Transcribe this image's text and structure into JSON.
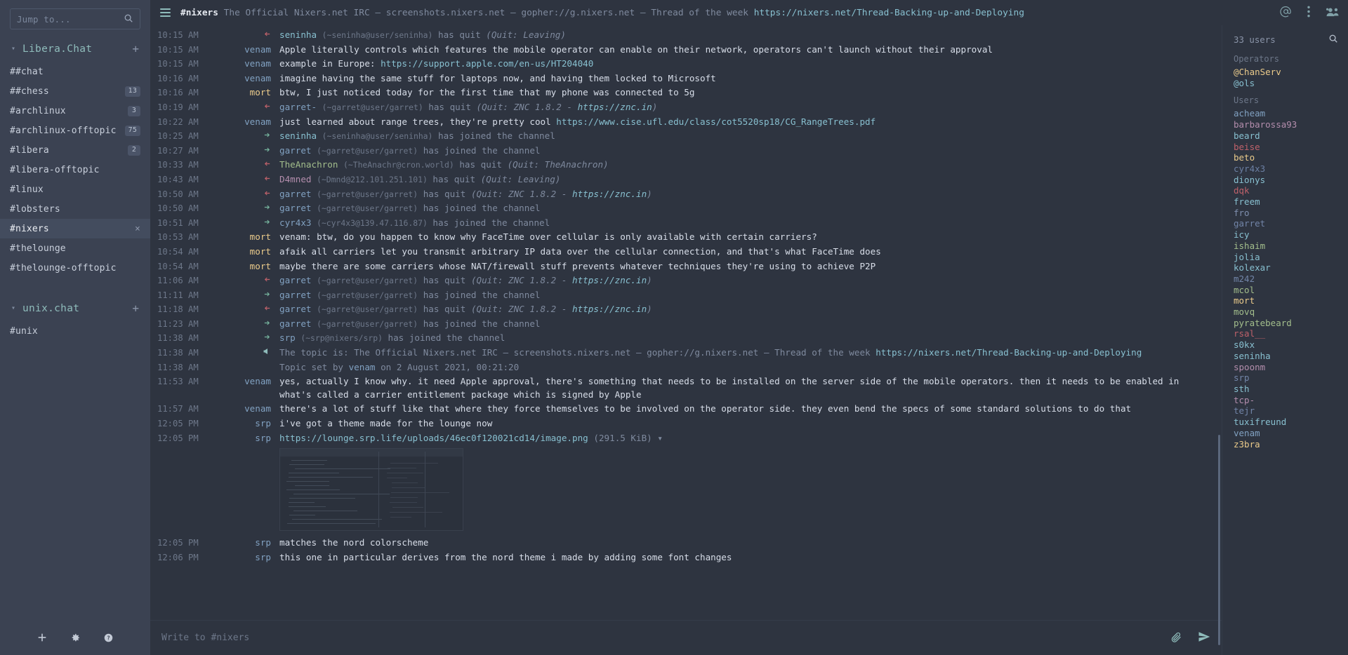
{
  "sidebar": {
    "search_placeholder": "Jump to...",
    "search_icon": "search-icon",
    "networks": [
      {
        "name": "Libera.Chat",
        "add_label": "+",
        "channels": [
          {
            "name": "##chat",
            "badge": "",
            "active": false
          },
          {
            "name": "##chess",
            "badge": "13",
            "active": false
          },
          {
            "name": "#archlinux",
            "badge": "3",
            "active": false
          },
          {
            "name": "#archlinux-offtopic",
            "badge": "75",
            "active": false
          },
          {
            "name": "#libera",
            "badge": "2",
            "active": false
          },
          {
            "name": "#libera-offtopic",
            "badge": "",
            "active": false
          },
          {
            "name": "#linux",
            "badge": "",
            "active": false
          },
          {
            "name": "#lobsters",
            "badge": "",
            "active": false
          },
          {
            "name": "#nixers",
            "badge": "",
            "active": true,
            "close": "×"
          },
          {
            "name": "#thelounge",
            "badge": "",
            "active": false
          },
          {
            "name": "#thelounge-offtopic",
            "badge": "",
            "active": false
          }
        ]
      },
      {
        "name": "unix.chat",
        "add_label": "+",
        "channels": [
          {
            "name": "#unix",
            "badge": "",
            "active": false
          }
        ]
      }
    ],
    "bottom_icons": [
      "plus-icon",
      "gear-icon",
      "help-icon"
    ]
  },
  "header": {
    "menu_icon": "hamburger-menu-icon",
    "channel": "#nixers",
    "topic_parts": [
      {
        "t": "The Official Nixers.net IRC — screenshots.nixers.net — gopher://g.nixers.net — Thread of the week ",
        "link": false
      },
      {
        "t": "https://nixers.net/Thread-Backing-up-and-Deploying",
        "link": true
      }
    ],
    "icons": [
      "mention-icon",
      "kebab-menu-icon",
      "user-list-icon"
    ]
  },
  "messages": [
    {
      "time": "10:15 AM",
      "kind": "quit",
      "nick": "seninha",
      "nickclass": "c-seninha",
      "host": "(~seninha@user/seninha)",
      "action": " has quit ",
      "quit": "(Quit: Leaving)"
    },
    {
      "time": "10:15 AM",
      "kind": "msg",
      "nick": "venam",
      "nickclass": "c-venam",
      "text": "Apple literally controls which features the mobile operator can enable on their network, operators can't launch without their approval"
    },
    {
      "time": "10:15 AM",
      "kind": "msg",
      "nick": "venam",
      "nickclass": "c-venam",
      "text": "example in Europe: ",
      "link": "https://support.apple.com/en-us/HT204040"
    },
    {
      "time": "10:16 AM",
      "kind": "msg",
      "nick": "venam",
      "nickclass": "c-venam",
      "text": "imagine having the same stuff for laptops now, and having them locked to Microsoft"
    },
    {
      "time": "10:16 AM",
      "kind": "msg",
      "nick": "mort",
      "nickclass": "c-mort",
      "text": "btw, I just noticed today for the first time that my phone was connected to 5g"
    },
    {
      "time": "10:19 AM",
      "kind": "quit",
      "nick": "garret-",
      "nickclass": "c-garret",
      "host": "(~garret@user/garret)",
      "action": " has quit ",
      "quit": "(Quit: ZNC 1.8.2 - https://znc.in)",
      "quitlink": "https://znc.in"
    },
    {
      "time": "10:22 AM",
      "kind": "msg",
      "nick": "venam",
      "nickclass": "c-venam",
      "text": "just learned about range trees, they're pretty cool ",
      "link": "https://www.cise.ufl.edu/class/cot5520sp18/CG_RangeTrees.pdf"
    },
    {
      "time": "10:25 AM",
      "kind": "join",
      "nick": "seninha",
      "nickclass": "c-seninha",
      "host": "(~seninha@user/seninha)",
      "action": " has joined the channel"
    },
    {
      "time": "10:27 AM",
      "kind": "join",
      "nick": "garret",
      "nickclass": "c-garret",
      "host": "(~garret@user/garret)",
      "action": " has joined the channel"
    },
    {
      "time": "10:33 AM",
      "kind": "quit",
      "nick": "TheAnachron",
      "nickclass": "c-anachron",
      "host": "(~TheAnachr@cron.world)",
      "action": " has quit ",
      "quit": "(Quit: TheAnachron)"
    },
    {
      "time": "10:43 AM",
      "kind": "quit",
      "nick": "D4mned",
      "nickclass": "c-d4mned",
      "host": "(~Dmnd@212.101.251.101)",
      "action": " has quit ",
      "quit": "(Quit: Leaving)"
    },
    {
      "time": "10:50 AM",
      "kind": "quit",
      "nick": "garret",
      "nickclass": "c-garret",
      "host": "(~garret@user/garret)",
      "action": " has quit ",
      "quit": "(Quit: ZNC 1.8.2 - https://znc.in)",
      "quitlink": "https://znc.in"
    },
    {
      "time": "10:50 AM",
      "kind": "join",
      "nick": "garret",
      "nickclass": "c-garret",
      "host": "(~garret@user/garret)",
      "action": " has joined the channel"
    },
    {
      "time": "10:51 AM",
      "kind": "join",
      "nick": "cyr4x3",
      "nickclass": "c-cyr4x3",
      "host": "(~cyr4x3@139.47.116.87)",
      "action": " has joined the channel"
    },
    {
      "time": "10:53 AM",
      "kind": "msg",
      "nick": "mort",
      "nickclass": "c-mort",
      "text": "venam: btw, do you happen to know why FaceTime over cellular is only available with certain carriers?"
    },
    {
      "time": "10:54 AM",
      "kind": "msg",
      "nick": "mort",
      "nickclass": "c-mort",
      "text": "afaik all carriers let you transmit arbitrary IP data over the cellular connection, and that's what FaceTime does"
    },
    {
      "time": "10:54 AM",
      "kind": "msg",
      "nick": "mort",
      "nickclass": "c-mort",
      "text": "maybe there are some carriers whose NAT/firewall stuff prevents whatever techniques they're using to achieve P2P"
    },
    {
      "time": "11:06 AM",
      "kind": "quit",
      "nick": "garret",
      "nickclass": "c-garret",
      "host": "(~garret@user/garret)",
      "action": " has quit ",
      "quit": "(Quit: ZNC 1.8.2 - https://znc.in)",
      "quitlink": "https://znc.in"
    },
    {
      "time": "11:11 AM",
      "kind": "join",
      "nick": "garret",
      "nickclass": "c-garret",
      "host": "(~garret@user/garret)",
      "action": " has joined the channel"
    },
    {
      "time": "11:18 AM",
      "kind": "quit",
      "nick": "garret",
      "nickclass": "c-garret",
      "host": "(~garret@user/garret)",
      "action": " has quit ",
      "quit": "(Quit: ZNC 1.8.2 - https://znc.in)",
      "quitlink": "https://znc.in"
    },
    {
      "time": "11:23 AM",
      "kind": "join",
      "nick": "garret",
      "nickclass": "c-garret",
      "host": "(~garret@user/garret)",
      "action": " has joined the channel"
    },
    {
      "time": "11:38 AM",
      "kind": "join",
      "nick": "srp",
      "nickclass": "c-srp",
      "host": "(~srp@nixers/srp)",
      "action": " has joined the channel"
    },
    {
      "time": "11:38 AM",
      "kind": "topic",
      "text": "The topic is: The Official Nixers.net IRC — screenshots.nixers.net — gopher://g.nixers.net — Thread of the week ",
      "link": "https://nixers.net/Thread-Backing-up-and-Deploying"
    },
    {
      "time": "11:38 AM",
      "kind": "topicset",
      "pre": "Topic set by ",
      "nick": "venam",
      "nickclass": "c-venam",
      "post": " on 2 August 2021, 00:21:20"
    },
    {
      "time": "11:53 AM",
      "kind": "msg",
      "nick": "venam",
      "nickclass": "c-venam",
      "text": "yes, actually I know why. it need Apple approval, there's something that needs to be installed on the server side of the mobile operators. then it needs to be enabled in what's called a carrier entitlement package which is signed by Apple"
    },
    {
      "time": "11:57 AM",
      "kind": "msg",
      "nick": "venam",
      "nickclass": "c-venam",
      "text": "there's a lot of stuff like that where they force themselves to be involved on the operator side. they even bend the specs of some standard solutions to do that"
    },
    {
      "time": "12:05 PM",
      "kind": "msg",
      "nick": "srp",
      "nickclass": "c-srp",
      "text": "i've got a theme made for the lounge now"
    },
    {
      "time": "12:05 PM",
      "kind": "image",
      "nick": "srp",
      "nickclass": "c-srp",
      "link": "https://lounge.srp.life/uploads/46ec0f120021cd14/image.png",
      "size": "(291.5 KiB)",
      "caret": "▾"
    },
    {
      "time": "12:05 PM",
      "kind": "msg",
      "nick": "srp",
      "nickclass": "c-srp",
      "text": "matches the nord colorscheme"
    },
    {
      "time": "12:06 PM",
      "kind": "msg",
      "nick": "srp",
      "nickclass": "c-srp",
      "text": "this one in particular derives from the nord theme i made by adding some font changes"
    }
  ],
  "composer": {
    "placeholder": "Write to #nixers",
    "icons": [
      "paperclip-icon",
      "send-icon"
    ]
  },
  "userlist": {
    "count": "33 users",
    "search_icon": "search-icon",
    "groups": [
      {
        "label": "Operators",
        "users": [
          {
            "name": "@ChanServ",
            "color": "#ebcb8b"
          },
          {
            "name": "@ols",
            "color": "#88c0d0"
          }
        ]
      },
      {
        "label": "Users",
        "users": [
          {
            "name": "acheam",
            "color": "#81a1c1"
          },
          {
            "name": "barbarossa93",
            "color": "#b48ead"
          },
          {
            "name": "beard",
            "color": "#88c0d0"
          },
          {
            "name": "beise",
            "color": "#bf616a"
          },
          {
            "name": "beto",
            "color": "#ebcb8b"
          },
          {
            "name": "cyr4x3",
            "color": "#6b7fa3"
          },
          {
            "name": "dionys",
            "color": "#88c0d0"
          },
          {
            "name": "dqk",
            "color": "#bf616a"
          },
          {
            "name": "freem",
            "color": "#88c0d0"
          },
          {
            "name": "fro",
            "color": "#7f8fae"
          },
          {
            "name": "garret",
            "color": "#7285a8"
          },
          {
            "name": "icy",
            "color": "#88c0d0"
          },
          {
            "name": "ishaim",
            "color": "#a3be8c"
          },
          {
            "name": "jolia",
            "color": "#88c0d0"
          },
          {
            "name": "kolexar",
            "color": "#88c0d0"
          },
          {
            "name": "m242",
            "color": "#7285a8"
          },
          {
            "name": "mcol",
            "color": "#a3be8c"
          },
          {
            "name": "mort",
            "color": "#ebcb8b"
          },
          {
            "name": "movq",
            "color": "#a3be8c"
          },
          {
            "name": "pyratebeard",
            "color": "#a3be8c"
          },
          {
            "name": "rsal__",
            "color": "#bf616a"
          },
          {
            "name": "s0kx",
            "color": "#88c0d0"
          },
          {
            "name": "seninha",
            "color": "#88c0d0"
          },
          {
            "name": "spoonm",
            "color": "#b48ead"
          },
          {
            "name": "srp",
            "color": "#7285a8"
          },
          {
            "name": "sth",
            "color": "#88c0d0"
          },
          {
            "name": "tcp-",
            "color": "#b48ead"
          },
          {
            "name": "tejr",
            "color": "#7285a8"
          },
          {
            "name": "tuxifreund",
            "color": "#88c0d0"
          },
          {
            "name": "venam",
            "color": "#81a1c1"
          },
          {
            "name": "z3bra",
            "color": "#ebcb8b"
          }
        ]
      }
    ]
  }
}
